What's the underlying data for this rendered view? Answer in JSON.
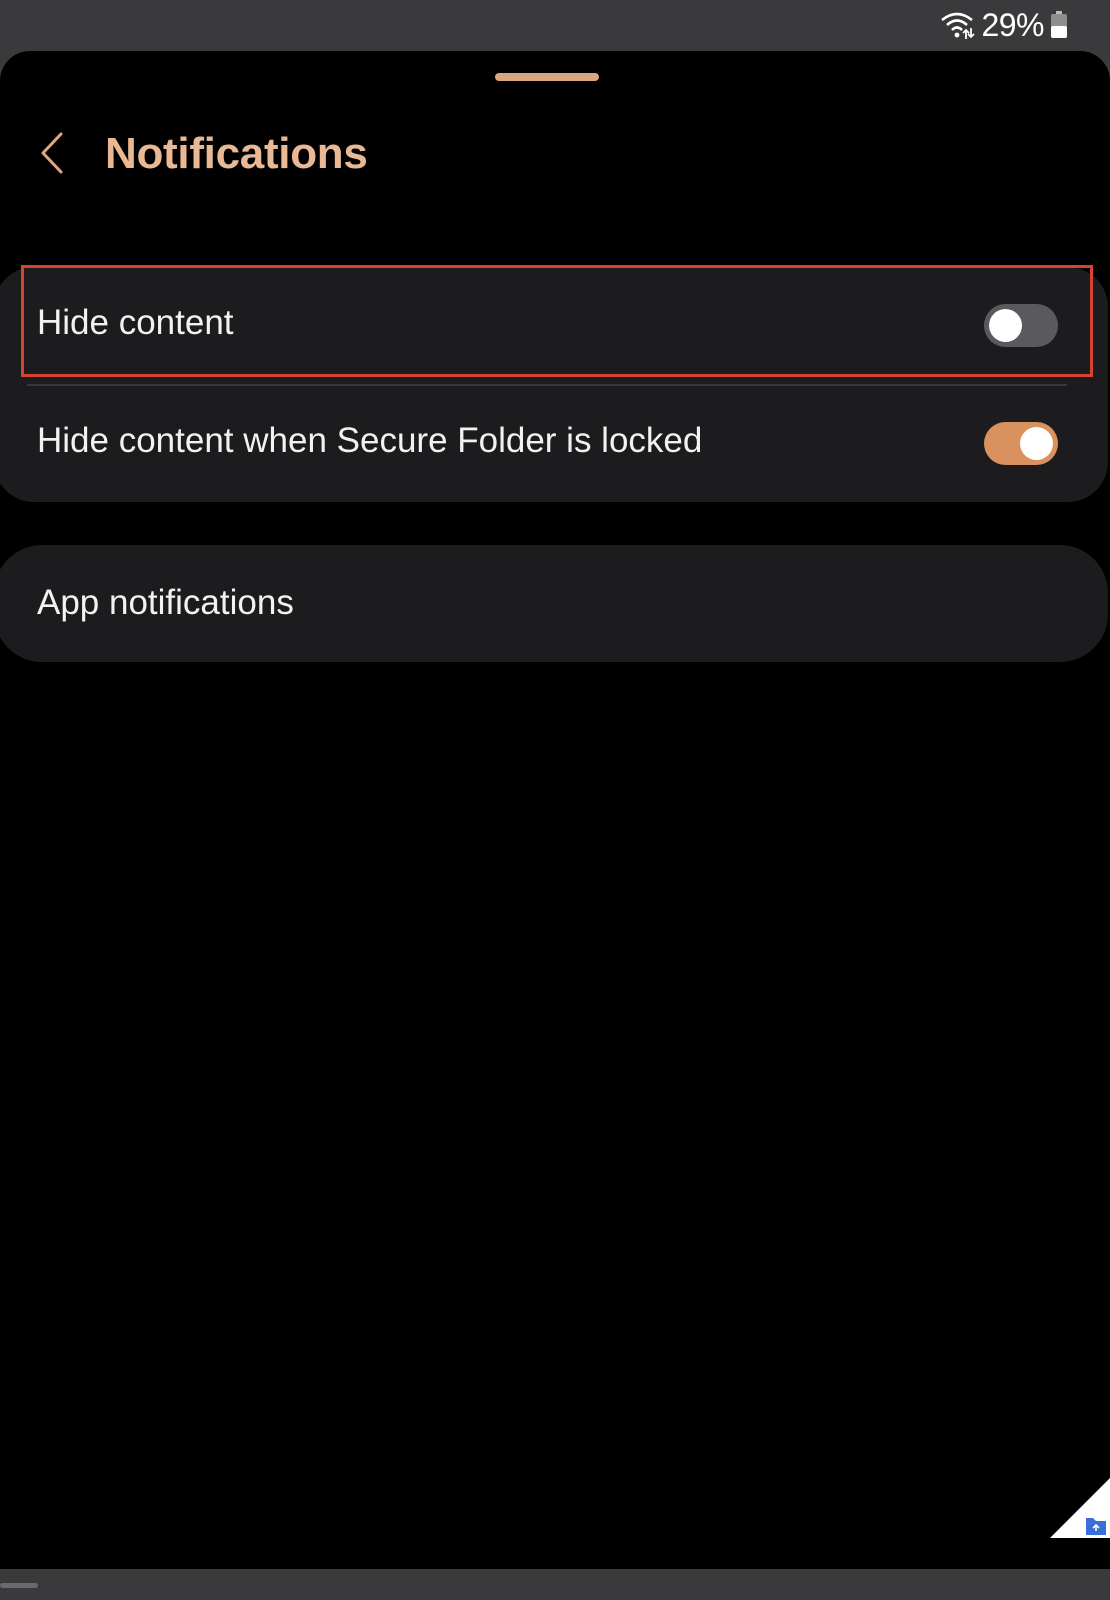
{
  "status_bar": {
    "battery_percent": "29%",
    "battery_level": 0.29,
    "icons": [
      "wifi-icon",
      "battery-icon"
    ]
  },
  "header": {
    "back_icon": "chevron-left-icon",
    "title": "Notifications"
  },
  "settings": [
    {
      "label": "Hide content",
      "toggle_on": false
    },
    {
      "label": "Hide content when Secure Folder is locked",
      "toggle_on": true
    }
  ],
  "app_notifications": {
    "label": "App notifications"
  },
  "colors": {
    "accent": "#d9925e",
    "title": "#e8b994",
    "toggle_off_track": "#5a5a5e",
    "card_bg": "#1c1c1e",
    "highlight": "#d8432f"
  }
}
